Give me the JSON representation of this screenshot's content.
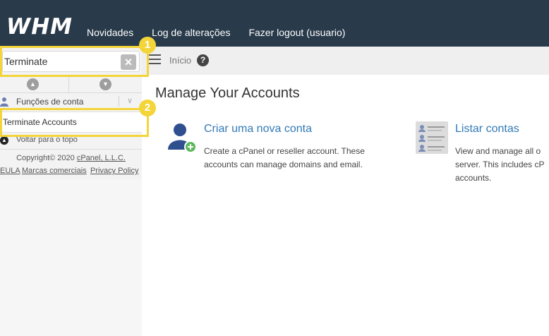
{
  "header": {
    "logo": "WHM",
    "nav": [
      "Novidades",
      "Log de alterações",
      "Fazer logout (usuario)"
    ]
  },
  "sidebar": {
    "search_value": "Terminate",
    "search_clear_icon": "×",
    "category": "Funções de conta",
    "result_item": "Terminate Accounts",
    "back_to_top": "Voltar para o topo",
    "copyright_prefix": "Copyright© 2020",
    "copyright_link": "cPanel, L.L.C.",
    "footer_links": [
      "EULA",
      "Marcas comerciais",
      "Privacy Policy"
    ]
  },
  "breadcrumb": {
    "home": "Início"
  },
  "main": {
    "title": "Manage Your Accounts",
    "cards": [
      {
        "title": "Criar uma nova conta",
        "desc_lines": [
          "Create a cPanel or reseller account. These",
          "accounts can manage domains and email."
        ],
        "icon": "add-user-icon"
      },
      {
        "title": "Listar contas",
        "desc_lines": [
          "View and manage all o",
          "server. This includes cP",
          "accounts."
        ],
        "icon": "list-accounts-icon"
      }
    ]
  },
  "annotations": {
    "badge1": "1",
    "badge2": "2",
    "color": "#f3d53a"
  }
}
